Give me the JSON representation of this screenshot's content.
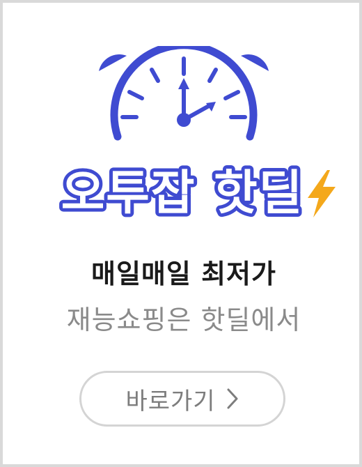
{
  "promo": {
    "brand_text": "오투잡 핫딜",
    "headline": "매일매일 최저가",
    "subline": "재능쇼핑은 핫딜에서",
    "cta_label": "바로가기"
  },
  "icons": {
    "clock": "alarm-clock-icon",
    "bolt": "lightning-bolt-icon",
    "chevron": "chevron-right-icon"
  },
  "colors": {
    "brand_blue": "#3f4bd1",
    "bolt_orange": "#f4a81b",
    "headline_text": "#1a1a1a",
    "subline_text": "#8a8a8a",
    "button_border": "#d4d4d4",
    "frame_border": "#d9d9d9"
  }
}
